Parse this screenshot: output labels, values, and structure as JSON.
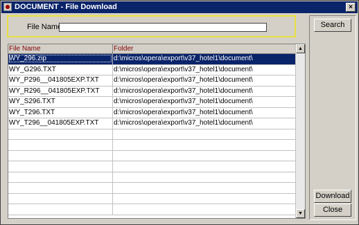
{
  "window": {
    "title": "DOCUMENT - File Download",
    "close_glyph": "×"
  },
  "search": {
    "label": "File Name",
    "value": ""
  },
  "buttons": {
    "search": "Search",
    "download": "Download",
    "close": "Close"
  },
  "grid": {
    "columns": [
      "File Name",
      "Folder"
    ],
    "rows": [
      {
        "file": "WY_296.zip",
        "folder": "d:\\micros\\opera\\export\\v37_hotel1\\document\\",
        "selected": true
      },
      {
        "file": "WY_G296.TXT",
        "folder": "d:\\micros\\opera\\export\\v37_hotel1\\document\\"
      },
      {
        "file": "WY_P296__041805EXP.TXT",
        "folder": "d:\\micros\\opera\\export\\v37_hotel1\\document\\"
      },
      {
        "file": "WY_R296__041805EXP.TXT",
        "folder": "d:\\micros\\opera\\export\\v37_hotel1\\document\\"
      },
      {
        "file": "WY_S296.TXT",
        "folder": "d:\\micros\\opera\\export\\v37_hotel1\\document\\"
      },
      {
        "file": "WY_T296.TXT",
        "folder": "d:\\micros\\opera\\export\\v37_hotel1\\document\\"
      },
      {
        "file": "WY_T296__041805EXP.TXT",
        "folder": "d:\\micros\\opera\\export\\v37_hotel1\\document\\"
      },
      {
        "file": "",
        "folder": ""
      },
      {
        "file": "",
        "folder": ""
      },
      {
        "file": "",
        "folder": ""
      },
      {
        "file": "",
        "folder": ""
      },
      {
        "file": "",
        "folder": ""
      },
      {
        "file": "",
        "folder": ""
      },
      {
        "file": "",
        "folder": ""
      },
      {
        "file": "",
        "folder": ""
      }
    ]
  },
  "colors": {
    "titlebar": "#0a246a",
    "selection": "#0a246a",
    "header_text": "#800000",
    "panel_border": "#e8e040"
  }
}
